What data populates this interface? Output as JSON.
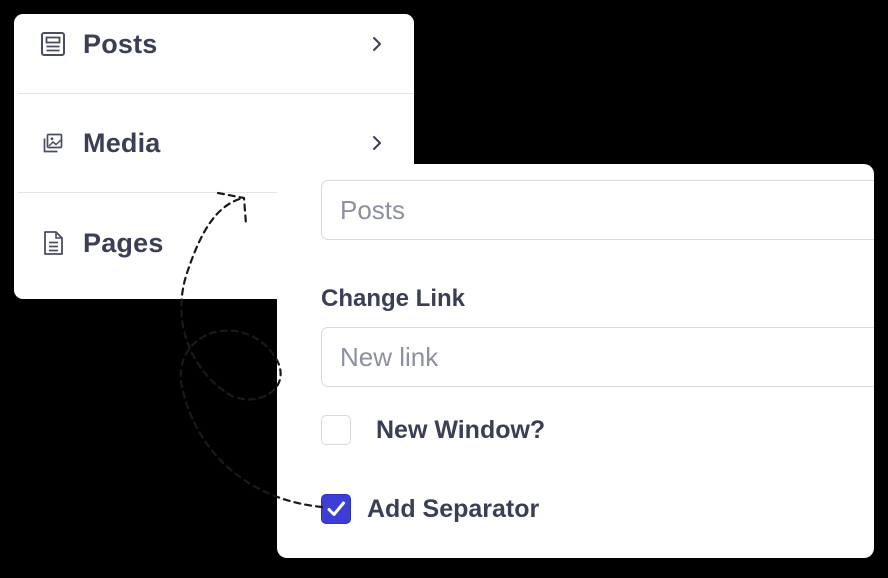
{
  "menu": {
    "items": [
      {
        "label": "Posts",
        "icon": "newspaper-icon"
      },
      {
        "label": "Media",
        "icon": "images-icon"
      },
      {
        "label": "Pages",
        "icon": "document-icon"
      }
    ]
  },
  "editor": {
    "title_input": {
      "placeholder": "Posts"
    },
    "change_link_label": "Change Link",
    "link_input": {
      "placeholder": "New link"
    },
    "new_window_label": "New Window?",
    "new_window_checked": false,
    "add_separator_label": "Add Separator",
    "add_separator_checked": true
  },
  "colors": {
    "background": "#000000",
    "card": "#ffffff",
    "text": "#3b3f55",
    "placeholder": "#8d90a1",
    "border": "#d6d8df",
    "accent": "#3d3fd4"
  }
}
